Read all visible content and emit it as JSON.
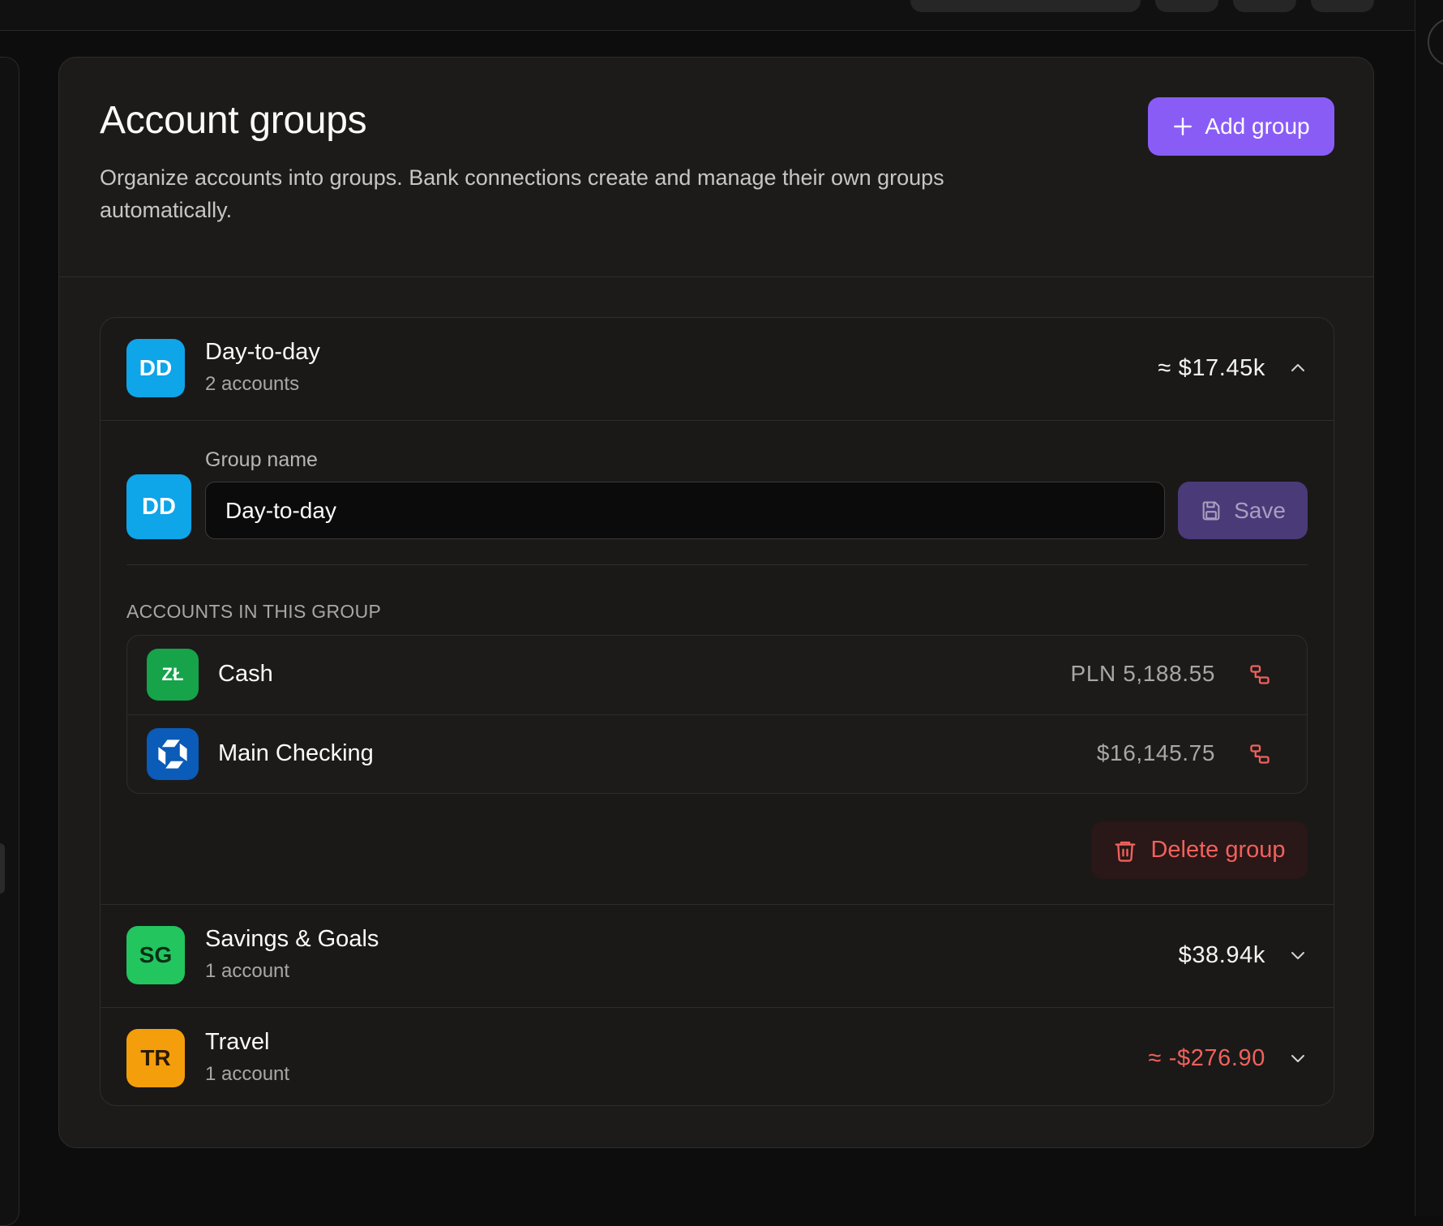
{
  "header": {
    "title": "Account groups",
    "description": "Organize accounts into groups. Bank connections create and manage their own groups automatically.",
    "add_group_label": "Add group"
  },
  "groups": [
    {
      "initials": "DD",
      "name": "Day-to-day",
      "count": "2 accounts",
      "total": "≈ $17.45k",
      "color": "#0ea5e9",
      "expanded": true
    },
    {
      "initials": "SG",
      "name": "Savings & Goals",
      "count": "1 account",
      "total": "$38.94k",
      "color": "#22c55e",
      "expanded": false
    },
    {
      "initials": "TR",
      "name": "Travel",
      "count": "1 account",
      "total": "≈ -$276.90",
      "color": "#f59e0b",
      "expanded": false
    }
  ],
  "editor": {
    "avatar_initials": "DD",
    "field_label": "Group name",
    "name_value": "Day-to-day",
    "save_label": "Save",
    "section_label": "ACCOUNTS IN THIS GROUP",
    "delete_label": "Delete group",
    "accounts": [
      {
        "icon_text": "ZŁ",
        "icon": "currency-icon",
        "icon_color": "#16a34a",
        "name": "Cash",
        "balance": "PLN 5,188.55"
      },
      {
        "icon": "bank-logo-icon",
        "icon_color": "#0b5bb8",
        "name": "Main Checking",
        "balance": "$16,145.75"
      }
    ]
  },
  "colors": {
    "accent": "#8a5cf6",
    "danger": "#f0615c",
    "panel": "#1c1b1a"
  }
}
